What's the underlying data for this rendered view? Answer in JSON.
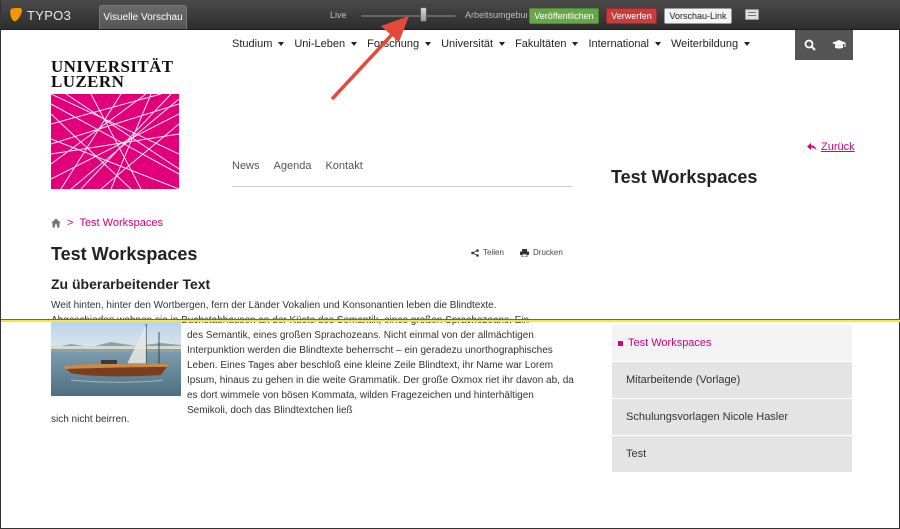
{
  "typo3": {
    "logo": "TYPO3",
    "tab_label": "Visuelle Vorschau",
    "live_label": "Live",
    "workspace_label": "Arbeitsumgebung",
    "publish_label": "Veröffentlichen",
    "discard_label": "Verwerfen",
    "preview_link_label": "Vorschau-Link",
    "slider_position": 0.66
  },
  "nav": {
    "items": [
      "Studium",
      "Uni-Leben",
      "Forschung",
      "Universität",
      "Fakultäten",
      "International",
      "Weiterbildung"
    ],
    "search_icon": "search-icon",
    "graduation_icon": "graduation-cap-icon"
  },
  "logo": {
    "line1": "UNIVERSITÄT",
    "line2": "LUZERN",
    "brand_color": "#e2007a"
  },
  "subnav": {
    "items": [
      "News",
      "Agenda",
      "Kontakt"
    ]
  },
  "back_link": "Zurück",
  "side_title": "Test Workspaces",
  "breadcrumb": {
    "home_icon": "home-icon",
    "current": "Test Workspaces"
  },
  "page_title": "Test Workspaces",
  "actions": {
    "share": "Teilen",
    "print": "Drucken"
  },
  "section_title": "Zu überarbeitender Text",
  "paragraph": {
    "line1": "Weit hinten, hinter den Wortbergen, fern der Länder Vokalien und Konsonantien leben die Blindtexte.",
    "line2": "Abgeschieden wohnen sie in Buchstabhausen an der Küste des Semantik, eines großen Sprachozeans. Ein",
    "block": "des Semantik, eines großen Sprachozeans. Nicht einmal von der allmächtigen Interpunktion werden die Blindtexte beherrscht – ein geradezu unorthographisches Leben. Eines Tages aber beschloß eine kleine Zeile Blindtext, ihr Name war Lorem Ipsum, hinaus zu gehen in die weite Grammatik. Der große Oxmox riet ihr davon ab, da es dort wimmele von bösen Kommata, wilden Fragezeichen und hinterhältigen Semikoli, doch das Blindtextchen ließ",
    "tail": "sich nicht beirren."
  },
  "side_menu": {
    "items": [
      "Test Workspaces",
      "Mitarbeitende (Vorlage)",
      "Schulungsvorlagen Nicole Hasler",
      "Test"
    ],
    "active_index": 0
  },
  "colors": {
    "accent": "#d2007a",
    "toolbar": "#3a3a3a",
    "diff_line": "#f5e63a"
  }
}
